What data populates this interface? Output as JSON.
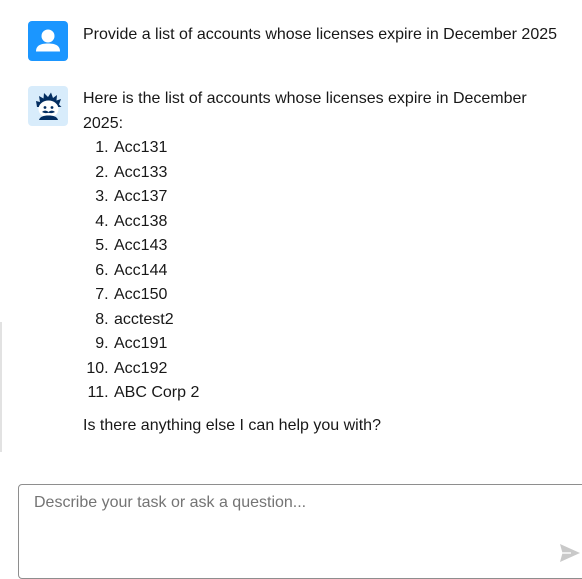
{
  "conversation": {
    "user_message": {
      "avatar_icon": "user-icon",
      "text": "Provide a list of accounts whose licenses expire in December 2025"
    },
    "assistant_message": {
      "avatar_icon": "einstein-bot-icon",
      "intro": "Here is the list of accounts whose licenses expire in December 2025:",
      "accounts": [
        "Acc131",
        "Acc133",
        "Acc137",
        "Acc138",
        "Acc143",
        "Acc144",
        "Acc150",
        "acctest2",
        "Acc191",
        "Acc192",
        "ABC Corp 2"
      ],
      "closing": "Is there anything else I can help you with?"
    }
  },
  "composer": {
    "placeholder": "Describe your task or ask a question...",
    "value": "",
    "send_icon": "send-icon"
  },
  "colors": {
    "user_avatar": "#1b96ff",
    "bot_avatar": "#d8ecfb",
    "bot_hair": "#032d60",
    "text": "#181818",
    "placeholder": "#747474",
    "send_icon": "#c9c9c9"
  }
}
